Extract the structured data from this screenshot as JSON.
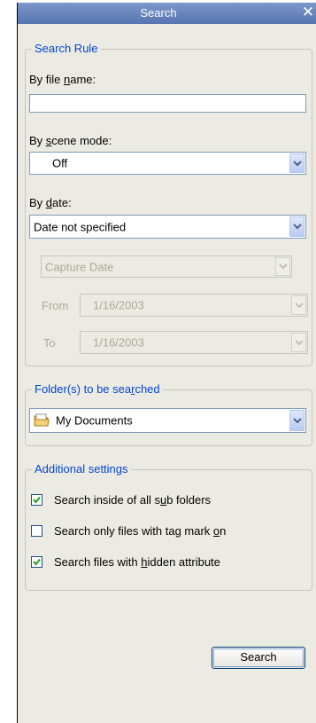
{
  "window": {
    "title": "Search",
    "close_glyph": "✕"
  },
  "search_rule": {
    "legend": "Search Rule",
    "file_name": {
      "label": "By file ",
      "label_u": "n",
      "label_rest": "ame:",
      "value": ""
    },
    "scene_mode": {
      "label": "By ",
      "label_u": "s",
      "label_rest": "cene mode:",
      "value": "Off"
    },
    "date": {
      "label": "By ",
      "label_u": "d",
      "label_rest": "ate:",
      "value": "Date not specified",
      "date_type": "Capture Date",
      "from_label": "From",
      "from_value": "1/16/2003",
      "to_label": "To",
      "to_value": "1/16/2003"
    }
  },
  "folders": {
    "legend_pre": "Folder(s) to be sea",
    "legend_u": "r",
    "legend_post": "ched",
    "value": "My Documents",
    "icon": "folder-icon"
  },
  "additional": {
    "legend": "Additional settings",
    "options": [
      {
        "pre": "Search inside of all s",
        "u": "u",
        "post": "b folders",
        "checked": true
      },
      {
        "pre": "Search only files with tag mark ",
        "u": "o",
        "post": "n",
        "checked": false
      },
      {
        "pre": "Search files with ",
        "u": "h",
        "post": "idden attribute",
        "checked": true
      }
    ]
  },
  "search_button_label": "Search",
  "colors": {
    "accent": "#0046d5",
    "title_bar": "#6b85bd",
    "panel": "#ecebe3",
    "check": "#21a121"
  }
}
